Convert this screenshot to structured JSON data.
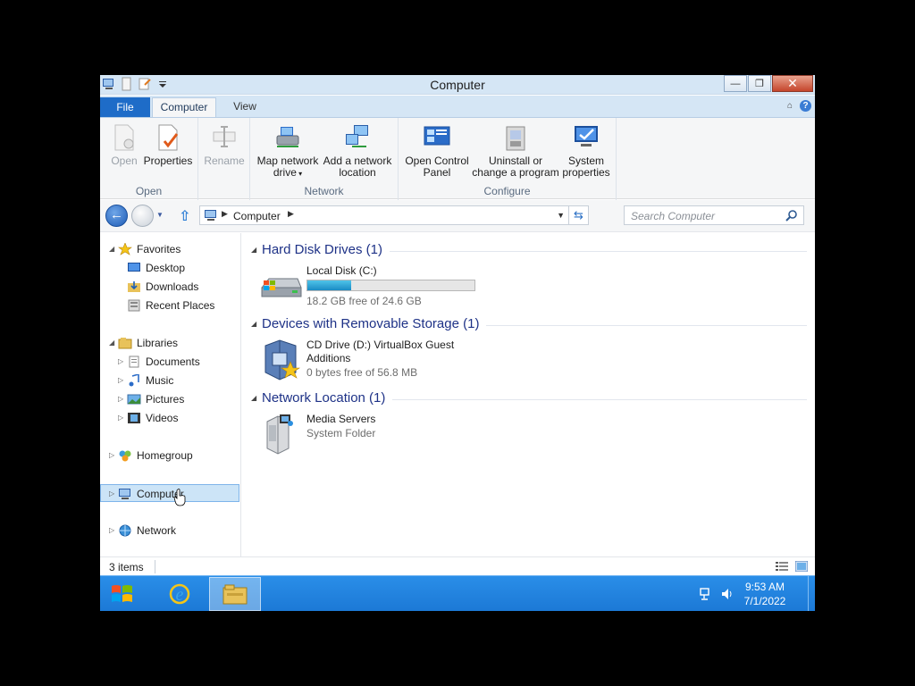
{
  "window": {
    "title": "Computer",
    "minimize": "—",
    "maximize": "❐",
    "close": "✕"
  },
  "ribbon": {
    "tabs": {
      "file": "File",
      "computer": "Computer",
      "view": "View"
    },
    "groups": {
      "open": {
        "label": "Open",
        "open": "Open",
        "properties": "Properties",
        "rename": "Rename"
      },
      "network": {
        "label": "Network",
        "map_drive_1": "Map network",
        "map_drive_2": "drive",
        "add_location_1": "Add a network",
        "add_location_2": "location"
      },
      "configure": {
        "label": "Configure",
        "control_panel_1": "Open Control",
        "control_panel_2": "Panel",
        "uninstall_1": "Uninstall or",
        "uninstall_2": "change a program",
        "system_1": "System",
        "system_2": "properties"
      }
    }
  },
  "address": {
    "crumb": "Computer",
    "search_placeholder": "Search Computer"
  },
  "nav": {
    "favorites": "Favorites",
    "desktop": "Desktop",
    "downloads": "Downloads",
    "recent_places": "Recent Places",
    "libraries": "Libraries",
    "documents": "Documents",
    "music": "Music",
    "pictures": "Pictures",
    "videos": "Videos",
    "homegroup": "Homegroup",
    "computer": "Computer",
    "network": "Network"
  },
  "content": {
    "groups": [
      {
        "title": "Hard Disk Drives (1)",
        "items": [
          {
            "name": "Local Disk (C:)",
            "sub": "18.2 GB free of 24.6 GB",
            "used_fraction": 0.26
          }
        ]
      },
      {
        "title": "Devices with Removable Storage (1)",
        "items": [
          {
            "name": "CD Drive (D:) VirtualBox Guest Additions",
            "sub": "0 bytes free of 56.8 MB"
          }
        ]
      },
      {
        "title": "Network Location (1)",
        "items": [
          {
            "name": "Media Servers",
            "sub": "System Folder"
          }
        ]
      }
    ]
  },
  "status": {
    "count": "3 items"
  },
  "taskbar": {
    "time": "9:53 AM",
    "date": "7/1/2022"
  },
  "colors": {
    "file_tab": "#1e6cc8",
    "taskbar": "#1c79d6",
    "group_title": "#1e3287",
    "selection": "#cce4f7"
  }
}
